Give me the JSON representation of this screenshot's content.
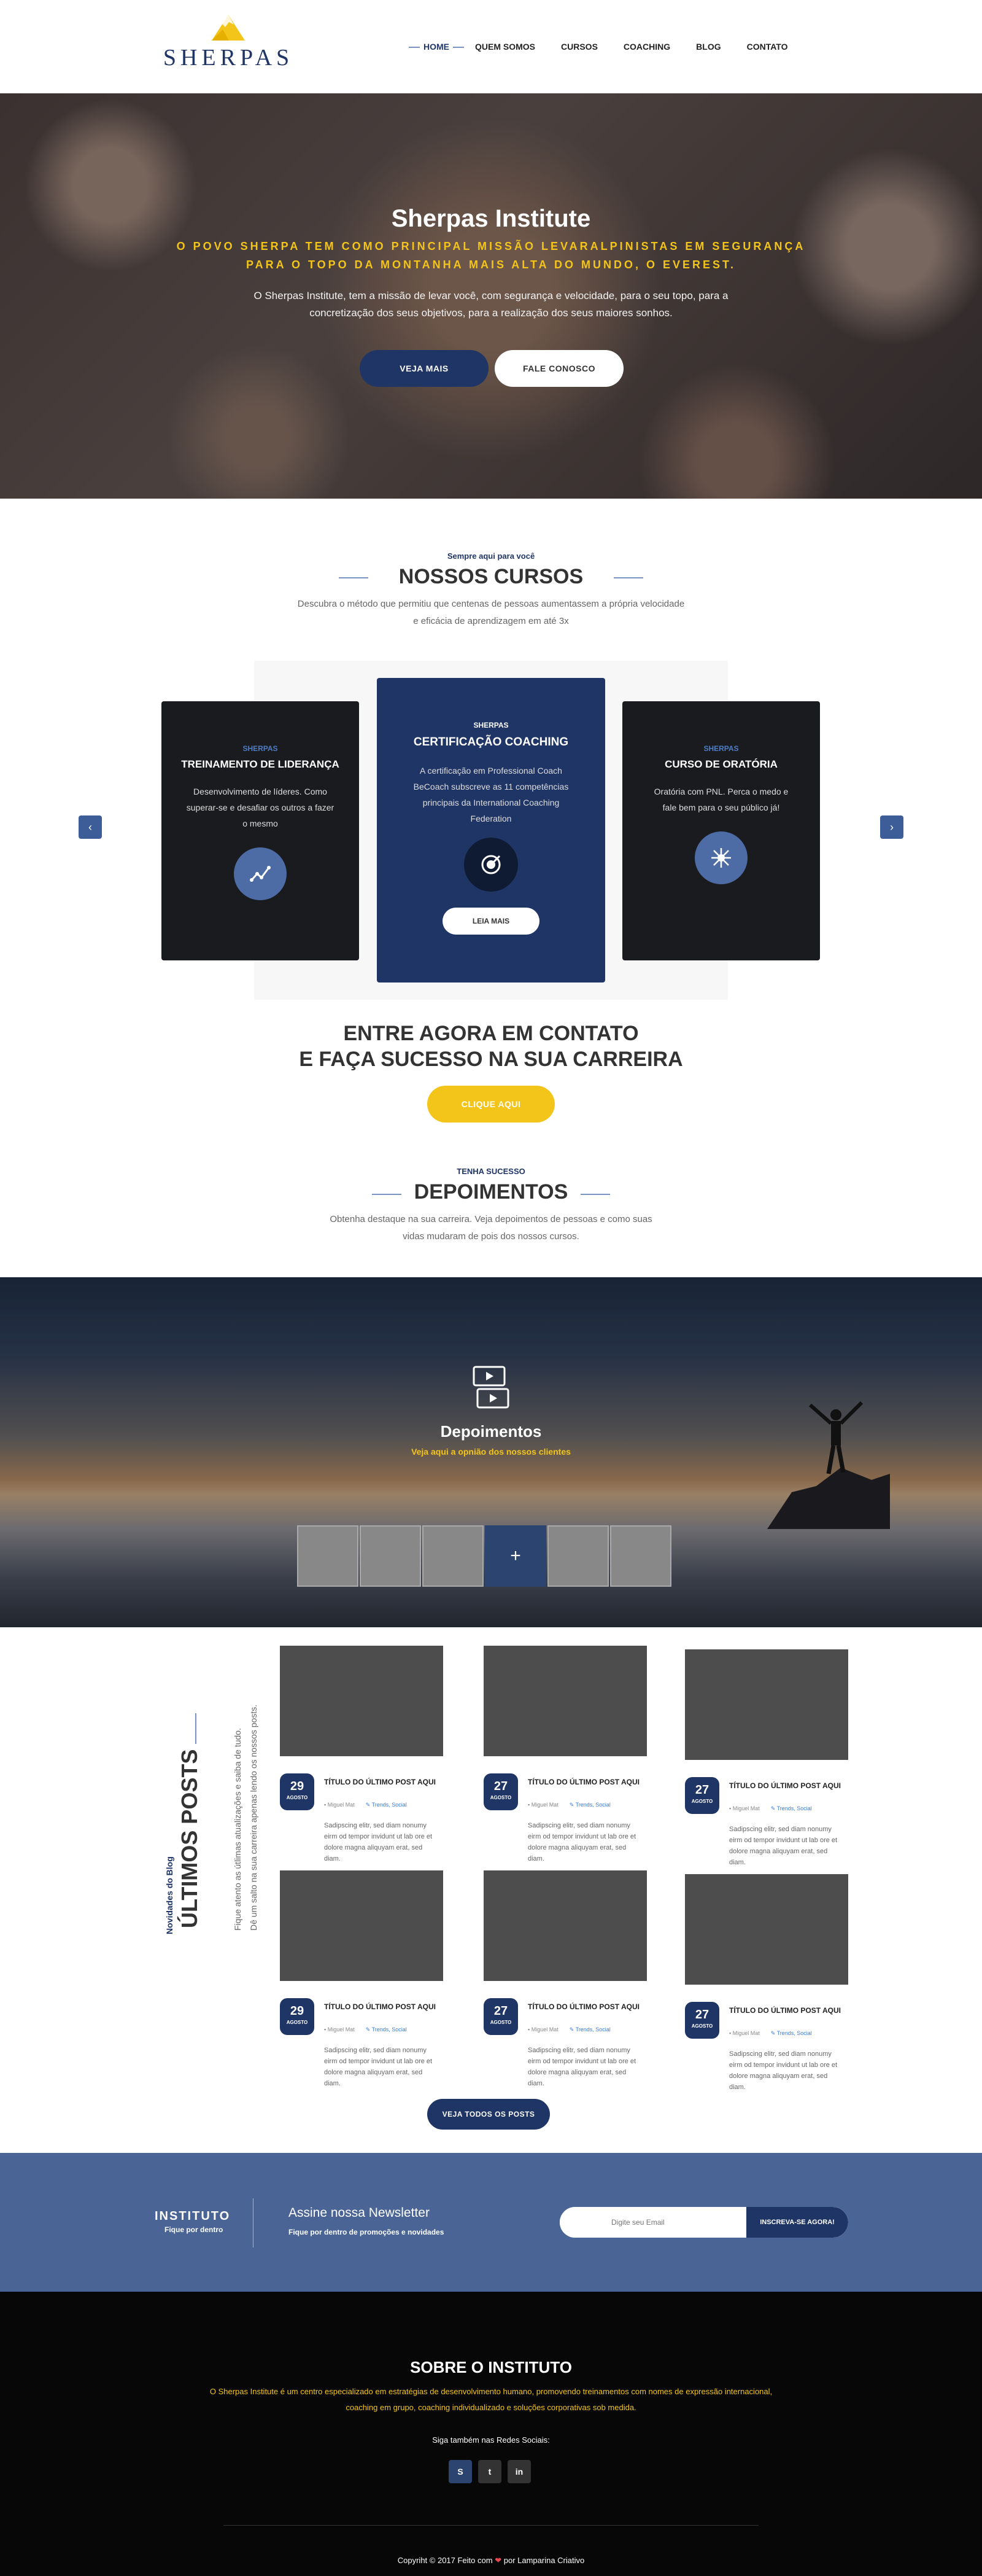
{
  "header": {
    "logo_text": "SHERPAS",
    "nav": [
      "HOME",
      "QUEM SOMOS",
      "CURSOS",
      "COACHING",
      "BLOG",
      "CONTATO"
    ]
  },
  "hero": {
    "title": "Sherpas Institute",
    "subtitle": "O POVO SHERPA TEM COMO PRINCIPAL MISSÃO LEVARALPINISTAS EM SEGURANÇA PARA O TOPO DA MONTANHA MAIS ALTA DO MUNDO, O EVEREST.",
    "description": "O Sherpas Institute, tem a missão de levar você, com segurança e velocidade, para o seu topo, para a concretização dos seus objetivos, para a realização dos seus maiores sonhos.",
    "btn_primary": "VEJA MAIS",
    "btn_secondary": "FALE CONOSCO"
  },
  "cursos": {
    "kicker": "Sempre aqui para você",
    "title": "NOSSOS CURSOS",
    "description": "Descubra o método que permitiu que centenas de pessoas aumentassem a própria velocidade e eficácia de aprendizagem em até 3x",
    "cards": [
      {
        "kicker": "SHERPAS",
        "title": "TREINAMENTO DE LIDERANÇA",
        "text": "Desenvolvimento de líderes. Como superar-se e desafiar os outros a fazer o mesmo"
      },
      {
        "kicker": "SHERPAS",
        "title": "CERTIFICAÇÃO COACHING",
        "text": "A certificação em Professional Coach BeCoach subscreve as 11 competências principais da International Coaching Federation",
        "button": "LEIA MAIS"
      },
      {
        "kicker": "SHERPAS",
        "title": "CURSO DE ORATÓRIA",
        "text": "Oratória com PNL. Perca o medo e fale bem para o seu público já!"
      }
    ],
    "prev_icon": "‹",
    "next_icon": "›"
  },
  "cta": {
    "line1": "ENTRE AGORA EM CONTATO",
    "line2": "E FAÇA SUCESSO NA SUA CARREIRA",
    "button": "CLIQUE AQUI"
  },
  "depoimentos": {
    "kicker": "TENHA SUCESSO",
    "title": "DEPOIMENTOS",
    "description": "Obtenha destaque na sua carreira. Veja depoimentos de pessoas e como suas vidas mudaram de pois dos nossos cursos.",
    "band_title": "Depoimentos",
    "band_sub": "Veja aqui a opnião dos nossos clientes",
    "plus": "+"
  },
  "blog": {
    "kicker": "Novidades do Blog",
    "title": "ÚLTIMOS POSTS",
    "desc_line1": "Fique atento as útlimas atualizações e saiba de tudo.",
    "desc_line2": "Dê um salto na sua carreira apenas lendo os nossos posts.",
    "posts": [
      {
        "day": "29",
        "month": "AGOSTO",
        "title": "TÍTULO DO ÚLTIMO POST AQUI",
        "author": "Miguel Mat",
        "tags": "Trends, Social",
        "excerpt": "Sadipscing elitr, sed diam nonumy eirm od tempor invidunt ut lab ore et dolore magna aliquyam erat, sed diam."
      },
      {
        "day": "27",
        "month": "AGOSTO",
        "title": "TÍTULO DO ÚLTIMO POST AQUI",
        "author": "Miguel Mat",
        "tags": "Trends, Social",
        "excerpt": "Sadipscing elitr, sed diam nonumy eirm od tempor invidunt ut lab ore et dolore magna aliquyam erat, sed diam."
      },
      {
        "day": "27",
        "month": "AGOSTO",
        "title": "TÍTULO DO ÚLTIMO POST AQUI",
        "author": "Miguel Mat",
        "tags": "Trends, Social",
        "excerpt": "Sadipscing elitr, sed diam nonumy eirm od tempor invidunt ut lab ore et dolore magna aliquyam erat, sed diam."
      },
      {
        "day": "29",
        "month": "AGOSTO",
        "title": "TÍTULO DO ÚLTIMO POST AQUI",
        "author": "Miguel Mat",
        "tags": "Trends, Social",
        "excerpt": "Sadipscing elitr, sed diam nonumy eirm od tempor invidunt ut lab ore et dolore magna aliquyam erat, sed diam."
      },
      {
        "day": "27",
        "month": "AGOSTO",
        "title": "TÍTULO DO ÚLTIMO POST AQUI",
        "author": "Miguel Mat",
        "tags": "Trends, Social",
        "excerpt": "Sadipscing elitr, sed diam nonumy eirm od tempor invidunt ut lab ore et dolore magna aliquyam erat, sed diam."
      },
      {
        "day": "27",
        "month": "AGOSTO",
        "title": "TÍTULO DO ÚLTIMO POST AQUI",
        "author": "Miguel Mat",
        "tags": "Trends, Social",
        "excerpt": "Sadipscing elitr, sed diam nonumy eirm od tempor invidunt ut lab ore et dolore magna aliquyam erat, sed diam."
      }
    ],
    "button": "VEJA TODOS OS POSTS"
  },
  "newsletter": {
    "brand": "INSTITUTO",
    "brand_sub": "Fique por dentro",
    "title": "Assine nossa Newsletter",
    "subtitle": "Fique por dentro de promoções e novidades",
    "placeholder": "Digite seu Email",
    "button": "INSCREVA-SE AGORA!"
  },
  "footer": {
    "title": "SOBRE O INSTITUTO",
    "description": "O Sherpas Institute é um centro especializado em estratégias de desenvolvimento humano, promovendo treinamentos com nomes de expressão internacional, coaching em grupo, coaching individualizado e soluções corporativas sob medida.",
    "social_label": "Siga também nas Redes Sociais:",
    "social": [
      {
        "icon": "skype-icon",
        "glyph": "S",
        "color": "#2b4470"
      },
      {
        "icon": "twitter-icon",
        "glyph": "t",
        "color": "#333333"
      },
      {
        "icon": "linkedin-icon",
        "glyph": "in",
        "color": "#333333"
      }
    ],
    "copy_pre": "Copyriht © 2017 Feito com",
    "heart": "❤",
    "copy_post": "por Lamparina Criativo"
  },
  "colors": {
    "navy": "#1f3566",
    "yellow": "#f3c51a",
    "blue": "#4a6595"
  }
}
